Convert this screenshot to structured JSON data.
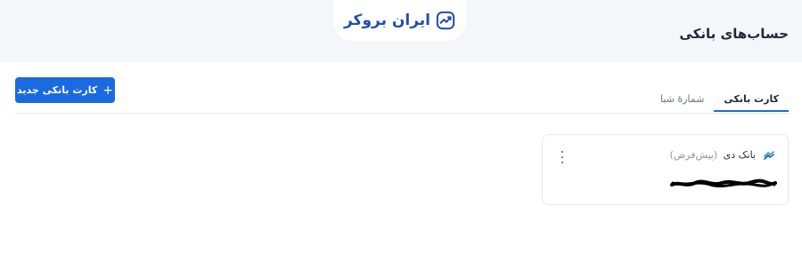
{
  "header": {
    "page_title": "حساب‌های بانکی",
    "brand_name": "ایران بروکر",
    "brand_color": "#1f4fa8",
    "brand_icon": "trending-up-icon"
  },
  "toolbar": {
    "add_card_label": "کارت بانکی جدید",
    "add_icon": "plus-icon",
    "accent_color": "#1a6ae0"
  },
  "tabs": [
    {
      "label": "کارت بانکی",
      "active": true
    },
    {
      "label": "شمارهٔ شبا",
      "active": false
    }
  ],
  "cards": [
    {
      "bank_name": "بانک دی",
      "default_tag": "(پیش‌فرض)",
      "bank_icon": "bank-dey-logo-icon",
      "more_icon": "more-vertical-icon",
      "card_number_redacted": true
    }
  ]
}
